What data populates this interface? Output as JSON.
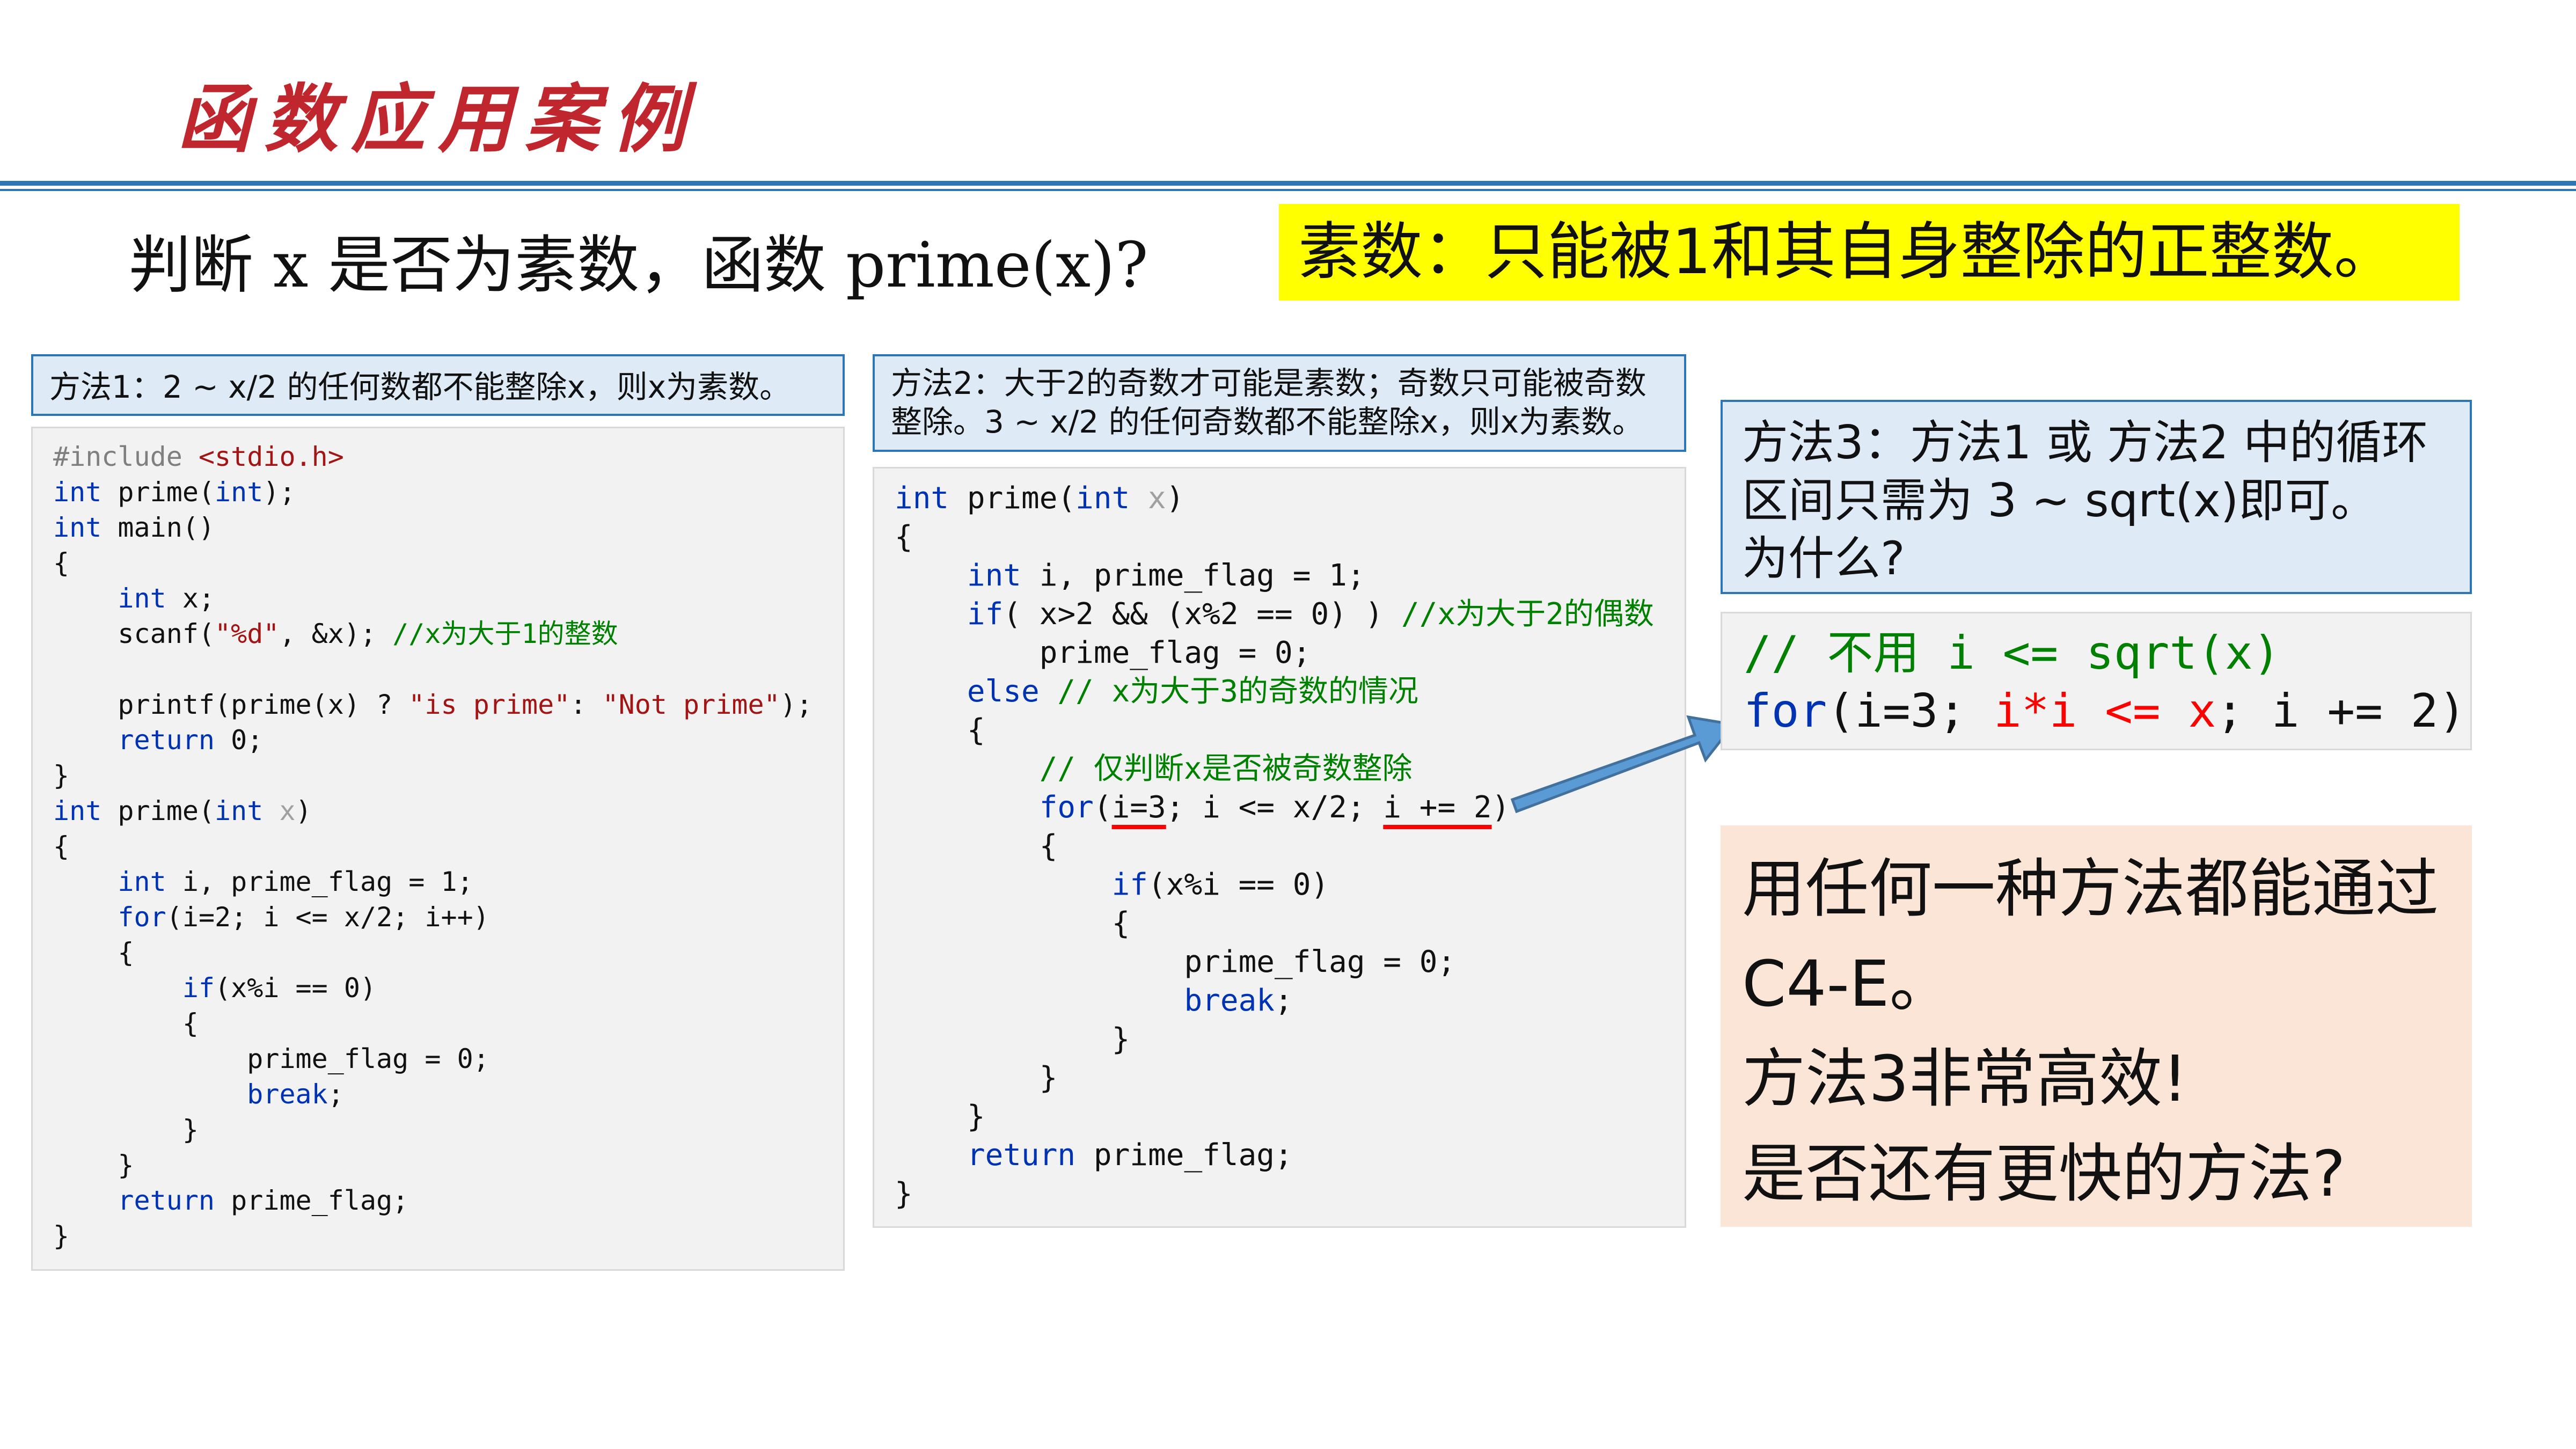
{
  "slide": {
    "title": "函数应用案例",
    "question": "判断 x 是否为素数，函数 prime(x)?",
    "definition": "素数：只能被1和其自身整除的正整数。"
  },
  "method1": {
    "heading": "方法1：2 ~ x/2 的任何数都不能整除x，则x为素数。",
    "code": {
      "include_dir": "#include ",
      "include_file": "<stdio.h>",
      "kw_int": "int",
      "prime_decl_rest": " prime(",
      "decl_close": ");",
      "main_rest": " main()",
      "open_brace": "{",
      "close_brace": "}",
      "x_decl": " x;",
      "scanf_open": "scanf(",
      "scanf_fmt": "\"%d\"",
      "scanf_rest": ", &x); ",
      "scanf_comment": "//x为大于1的整数",
      "printf_open": "printf(prime(x) ? ",
      "printf_is": "\"is prime\"",
      "printf_colon": ": ",
      "printf_not": "\"Not prime\"",
      "printf_close": ");",
      "kw_return": "return",
      "return0": " 0;",
      "prime_def_rest": " prime(",
      "param_x": "x",
      "close_paren": ")",
      "vars_rest": " i, prime_flag = 1;",
      "kw_for": "for",
      "for_rest": "(i=2; i <= x/2; i++)",
      "kw_if": "if",
      "if_rest": "(x%i == 0)",
      "flag_zero": "prime_flag = 0;",
      "kw_break": "break",
      "semicolon": ";",
      "return_flag": " prime_flag;"
    }
  },
  "method2": {
    "heading_line1": "方法2：大于2的奇数才可能是素数；奇数只可能被奇数",
    "heading_line2": "整除。3 ~ x/2 的任何奇数都不能整除x，则x为素数。",
    "code": {
      "kw_int": "int",
      "prime_def_rest": " prime(",
      "param_x": "x",
      "close_paren": ")",
      "open_brace": "{",
      "close_brace": "}",
      "vars_rest": " i, prime_flag = 1;",
      "kw_if": "if",
      "if_even_rest": "( x>2 && (x%2 == 0) ) ",
      "even_comment": "//x为大于2的偶数",
      "flag_zero": "prime_flag = 0;",
      "kw_else": "else",
      "odd_comment": " // x为大于3的奇数的情况",
      "only_comment": "// 仅判断x是否被奇数整除",
      "kw_for": "for",
      "for_open": "(",
      "for_init": "i=3",
      "for_mid": "; i <= x/2; ",
      "for_step": "i += 2",
      "if_rest": "(x%i == 0)",
      "kw_break": "break",
      "semicolon": ";",
      "kw_return": "return",
      "return_flag": " prime_flag;"
    }
  },
  "method3": {
    "heading_line1": "方法3：方法1 或 方法2 中的循环",
    "heading_line2": "区间只需为 3 ~ sqrt(x)即可。",
    "heading_line3": "为什么?",
    "code": {
      "comment": "// 不用 i <= sqrt(x)",
      "kw_for": "for",
      "for_open": "(i=3; ",
      "cond_i": "i*i",
      "cond_le": " <= ",
      "cond_x": "x",
      "for_rest": "; i += 2)"
    }
  },
  "note": {
    "line1": "用任何一种方法都能通过",
    "line2": "C4-E。",
    "line3": "方法3非常高效!",
    "line4": "是否还有更快的方法?"
  },
  "colors": {
    "title_red": "#c0262d",
    "rule_blue": "#2e75b6",
    "highlight_yellow": "#ffff00",
    "heading_box_fill": "#deebf7",
    "code_box_fill": "#f2f2f2",
    "note_box_fill": "#fbe5d6",
    "keyword_blue": "#0033b3",
    "string_red": "#a31515",
    "comment_green": "#008000",
    "arrow_blue": "#5b9bd5"
  }
}
